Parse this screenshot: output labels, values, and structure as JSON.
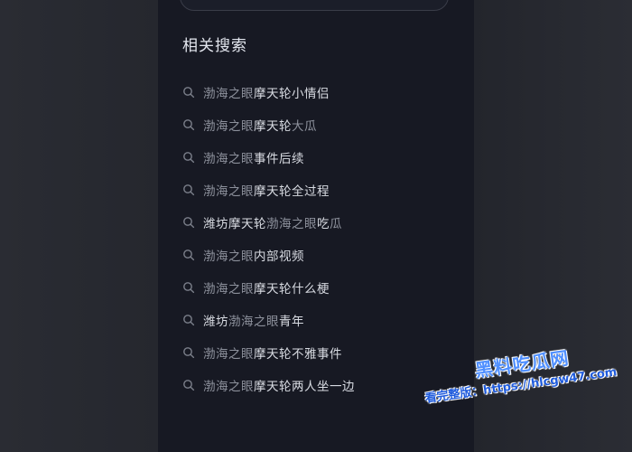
{
  "related_search": {
    "title": "相关搜索",
    "items": [
      {
        "segments": [
          {
            "text": "渤海之眼",
            "style": "dim"
          },
          {
            "text": "摩天轮小情侣",
            "style": "bright"
          }
        ]
      },
      {
        "segments": [
          {
            "text": "渤海之眼",
            "style": "dim"
          },
          {
            "text": "摩天轮",
            "style": "bright"
          },
          {
            "text": "大瓜",
            "style": "dim"
          }
        ]
      },
      {
        "segments": [
          {
            "text": "渤海之眼",
            "style": "dim"
          },
          {
            "text": "事件后续",
            "style": "bright"
          }
        ]
      },
      {
        "segments": [
          {
            "text": "渤海之眼",
            "style": "dim"
          },
          {
            "text": "摩天轮全过程",
            "style": "bright"
          }
        ]
      },
      {
        "segments": [
          {
            "text": "潍坊摩天轮",
            "style": "bright"
          },
          {
            "text": "渤海之眼",
            "style": "dim"
          },
          {
            "text": "吃",
            "style": "bright"
          },
          {
            "text": "瓜",
            "style": "dim"
          }
        ]
      },
      {
        "segments": [
          {
            "text": "渤海之眼",
            "style": "dim"
          },
          {
            "text": "内部视频",
            "style": "bright"
          }
        ]
      },
      {
        "segments": [
          {
            "text": "渤海之眼",
            "style": "dim"
          },
          {
            "text": "摩天轮什么梗",
            "style": "bright"
          }
        ]
      },
      {
        "segments": [
          {
            "text": "潍坊",
            "style": "bright"
          },
          {
            "text": "渤海之眼",
            "style": "dim"
          },
          {
            "text": "青年",
            "style": "bright"
          }
        ]
      },
      {
        "segments": [
          {
            "text": "渤海之眼",
            "style": "dim"
          },
          {
            "text": "摩天轮不雅事件",
            "style": "bright"
          }
        ]
      },
      {
        "segments": [
          {
            "text": "渤海之眼",
            "style": "dim"
          },
          {
            "text": "摩天轮两人坐一边",
            "style": "bright"
          }
        ]
      }
    ]
  },
  "watermark": {
    "title": "黑料吃瓜网",
    "url_line": "看完整版：https://hlcgw47.com"
  },
  "colors": {
    "panel_bg": "#171923",
    "page_bg": "#23252c",
    "text_dim": "#8d919c",
    "text_bright": "#d8dbe2",
    "watermark_blue": "#4f8fff"
  },
  "icons": {
    "search_item": "search-icon"
  }
}
